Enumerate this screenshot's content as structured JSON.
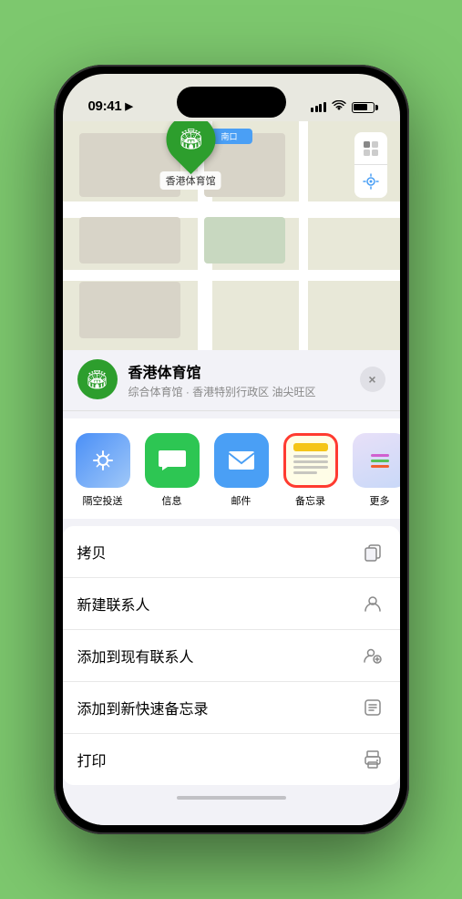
{
  "status_bar": {
    "time": "09:41",
    "location_arrow": "▶"
  },
  "map": {
    "location_label": "南口",
    "venue_name_pin": "香港体育馆",
    "venue_pin_emoji": "🏟"
  },
  "map_controls": {
    "map_btn": "🗺",
    "location_btn": "➤"
  },
  "venue_info": {
    "name": "香港体育馆",
    "subtitle": "综合体育馆 · 香港特别行政区 油尖旺区",
    "icon_emoji": "🏟",
    "close_label": "×"
  },
  "share_actions": [
    {
      "id": "airdrop",
      "label": "隔空投送",
      "type": "airdrop"
    },
    {
      "id": "messages",
      "label": "信息",
      "type": "messages"
    },
    {
      "id": "mail",
      "label": "邮件",
      "type": "mail"
    },
    {
      "id": "notes",
      "label": "备忘录",
      "type": "notes"
    },
    {
      "id": "more",
      "label": "更多",
      "type": "more"
    }
  ],
  "menu_items": [
    {
      "id": "copy",
      "label": "拷贝",
      "icon": "copy"
    },
    {
      "id": "new_contact",
      "label": "新建联系人",
      "icon": "person"
    },
    {
      "id": "add_existing",
      "label": "添加到现有联系人",
      "icon": "person_add"
    },
    {
      "id": "add_note",
      "label": "添加到新快速备忘录",
      "icon": "note"
    },
    {
      "id": "print",
      "label": "打印",
      "icon": "printer"
    }
  ],
  "colors": {
    "green_accent": "#2d9e2d",
    "blue_accent": "#4a9ff5",
    "background": "#7dc86e",
    "sheet_bg": "#f2f2f7",
    "notes_selected_border": "#ff3b30"
  }
}
